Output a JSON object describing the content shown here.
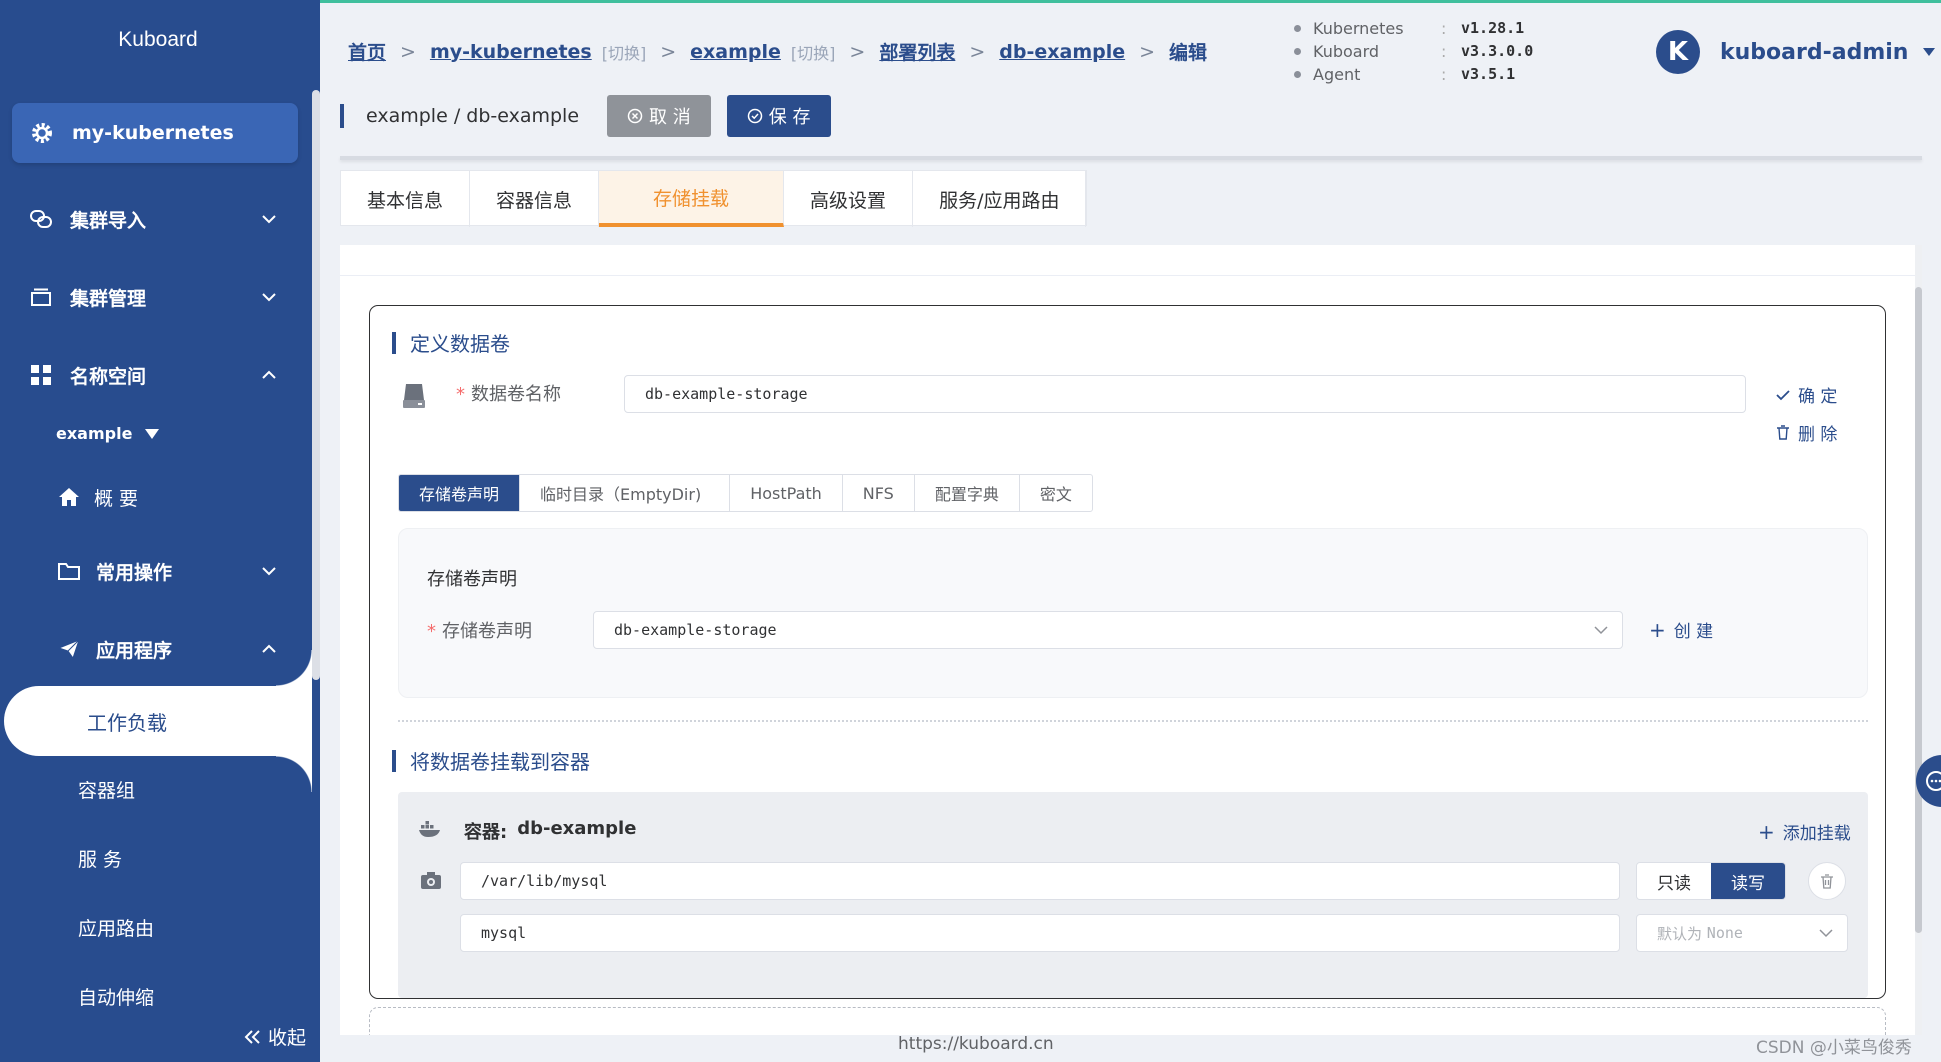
{
  "sidebar": {
    "brand": "Kuboard",
    "cluster": "my-kubernetes",
    "items": [
      {
        "label": "集群导入"
      },
      {
        "label": "集群管理"
      },
      {
        "label": "名称空间"
      }
    ],
    "namespace": "example",
    "ns_items": [
      {
        "label": "概 要"
      },
      {
        "label": "常用操作"
      },
      {
        "label": "应用程序"
      }
    ],
    "app_items": [
      {
        "label": "工作负载"
      },
      {
        "label": "容器组"
      },
      {
        "label": "服 务"
      },
      {
        "label": "应用路由"
      },
      {
        "label": "自动伸缩"
      }
    ],
    "collapse": "收起"
  },
  "breadcrumb": {
    "home": "首页",
    "cluster": "my-kubernetes",
    "switch": "[切换]",
    "namespace": "example",
    "deployments": "部署列表",
    "workload": "db-example",
    "current": "编辑"
  },
  "versions": [
    {
      "name": "Kubernetes",
      "colon": ":",
      "value": "v1.28.1"
    },
    {
      "name": "Kuboard",
      "colon": ":",
      "value": "v3.3.0.0"
    },
    {
      "name": "Agent",
      "colon": ":",
      "value": "v3.5.1"
    }
  ],
  "user": {
    "initial": "K",
    "name": "kuboard-admin"
  },
  "title": {
    "path": "example / db-example",
    "cancel": "取 消",
    "save": "保 存"
  },
  "tabs": [
    "基本信息",
    "容器信息",
    "存储挂载",
    "高级设置",
    "服务/应用路由"
  ],
  "volume": {
    "section_title": "定义数据卷",
    "name_label": "数据卷名称",
    "name_value": "db-example-storage",
    "confirm": "确 定",
    "delete": "删 除",
    "type_tabs": [
      "存储卷声明",
      "临时目录（EmptyDir)",
      "HostPath",
      "NFS",
      "配置字典",
      "密文"
    ],
    "pvc_title": "存储卷声明",
    "pvc_label": "存储卷声明",
    "pvc_value": "db-example-storage",
    "create": "创 建"
  },
  "mount": {
    "section_title": "将数据卷挂载到容器",
    "container_label": "容器:",
    "container_name": "db-example",
    "add": "添加挂载",
    "mount_path": "/var/lib/mysql",
    "sub_path": "mysql",
    "readonly": "只读",
    "readwrite": "读写",
    "propagation_placeholder_cn": "默认为",
    "propagation_placeholder_en": "None"
  },
  "footer": {
    "url": "https://kuboard.cn",
    "watermark": "CSDN @小菜鸟俊秀"
  }
}
